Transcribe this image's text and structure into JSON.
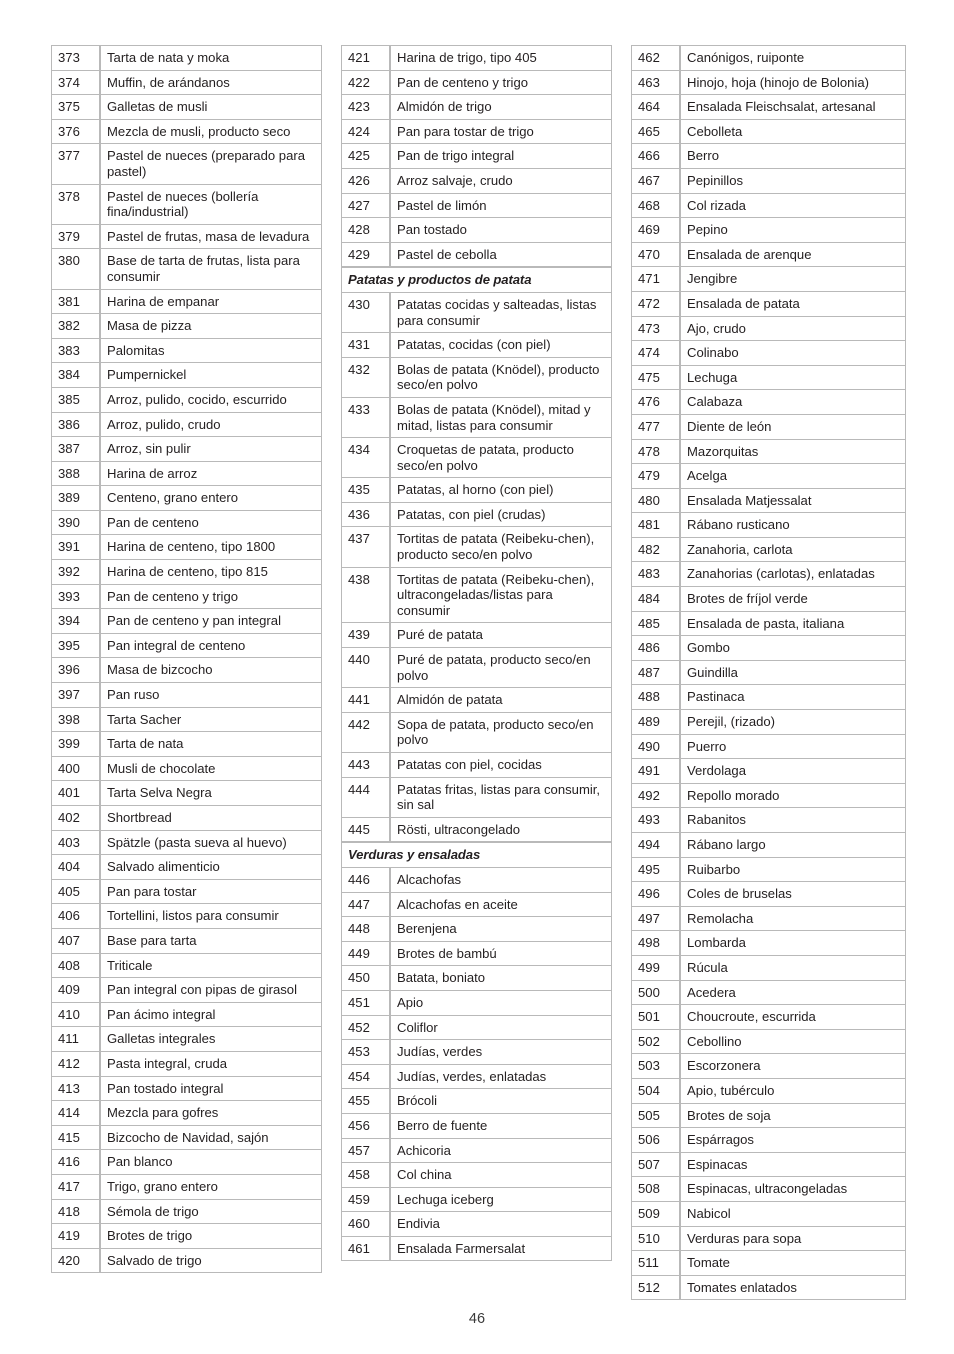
{
  "document": {
    "page_number": "46",
    "columns": [
      {
        "id": "column-1",
        "rows": [
          {
            "type": "entry",
            "num": "373",
            "name": "Tarta de nata y moka"
          },
          {
            "type": "entry",
            "num": "374",
            "name": "Muffin, de arándanos"
          },
          {
            "type": "entry",
            "num": "375",
            "name": "Galletas de musli"
          },
          {
            "type": "entry",
            "num": "376",
            "name": "Mezcla de musli, producto seco"
          },
          {
            "type": "entry",
            "num": "377",
            "name": "Pastel de nueces (preparado para pastel)"
          },
          {
            "type": "entry",
            "num": "378",
            "name": "Pastel de nueces (bollería fina/industrial)"
          },
          {
            "type": "entry",
            "num": "379",
            "name": "Pastel de frutas, masa de levadura"
          },
          {
            "type": "entry",
            "num": "380",
            "name": "Base de tarta de frutas, lista para consumir"
          },
          {
            "type": "entry",
            "num": "381",
            "name": "Harina de empanar"
          },
          {
            "type": "entry",
            "num": "382",
            "name": "Masa de pizza"
          },
          {
            "type": "entry",
            "num": "383",
            "name": "Palomitas"
          },
          {
            "type": "entry",
            "num": "384",
            "name": "Pumpernickel"
          },
          {
            "type": "entry",
            "num": "385",
            "name": "Arroz, pulido, cocido, escurrido"
          },
          {
            "type": "entry",
            "num": "386",
            "name": "Arroz, pulido, crudo"
          },
          {
            "type": "entry",
            "num": "387",
            "name": "Arroz, sin pulir"
          },
          {
            "type": "entry",
            "num": "388",
            "name": "Harina de arroz"
          },
          {
            "type": "entry",
            "num": "389",
            "name": "Centeno, grano entero"
          },
          {
            "type": "entry",
            "num": "390",
            "name": "Pan de centeno"
          },
          {
            "type": "entry",
            "num": "391",
            "name": "Harina de centeno, tipo 1800"
          },
          {
            "type": "entry",
            "num": "392",
            "name": "Harina de centeno, tipo 815"
          },
          {
            "type": "entry",
            "num": "393",
            "name": "Pan de centeno y trigo"
          },
          {
            "type": "entry",
            "num": "394",
            "name": "Pan de centeno y pan integral"
          },
          {
            "type": "entry",
            "num": "395",
            "name": "Pan integral de centeno"
          },
          {
            "type": "entry",
            "num": "396",
            "name": "Masa de bizcocho"
          },
          {
            "type": "entry",
            "num": "397",
            "name": "Pan ruso"
          },
          {
            "type": "entry",
            "num": "398",
            "name": "Tarta Sacher"
          },
          {
            "type": "entry",
            "num": "399",
            "name": "Tarta de nata"
          },
          {
            "type": "entry",
            "num": "400",
            "name": "Musli de chocolate"
          },
          {
            "type": "entry",
            "num": "401",
            "name": "Tarta Selva Negra"
          },
          {
            "type": "entry",
            "num": "402",
            "name": "Shortbread"
          },
          {
            "type": "entry",
            "num": "403",
            "name": "Spätzle (pasta sueva al huevo)"
          },
          {
            "type": "entry",
            "num": "404",
            "name": "Salvado alimenticio"
          },
          {
            "type": "entry",
            "num": "405",
            "name": "Pan para tostar"
          },
          {
            "type": "entry",
            "num": "406",
            "name": "Tortellini, listos para consumir"
          },
          {
            "type": "entry",
            "num": "407",
            "name": "Base para tarta"
          },
          {
            "type": "entry",
            "num": "408",
            "name": "Triticale"
          },
          {
            "type": "entry",
            "num": "409",
            "name": "Pan integral con pipas de girasol"
          },
          {
            "type": "entry",
            "num": "410",
            "name": "Pan ácimo integral"
          },
          {
            "type": "entry",
            "num": "411",
            "name": "Galletas integrales"
          },
          {
            "type": "entry",
            "num": "412",
            "name": "Pasta integral, cruda"
          },
          {
            "type": "entry",
            "num": "413",
            "name": "Pan tostado integral"
          },
          {
            "type": "entry",
            "num": "414",
            "name": "Mezcla para gofres"
          },
          {
            "type": "entry",
            "num": "415",
            "name": "Bizcocho de Navidad, sajón"
          },
          {
            "type": "entry",
            "num": "416",
            "name": "Pan blanco"
          },
          {
            "type": "entry",
            "num": "417",
            "name": "Trigo, grano entero"
          },
          {
            "type": "entry",
            "num": "418",
            "name": "Sémola de trigo"
          },
          {
            "type": "entry",
            "num": "419",
            "name": "Brotes de trigo"
          },
          {
            "type": "entry",
            "num": "420",
            "name": "Salvado de trigo"
          }
        ]
      },
      {
        "id": "column-2",
        "rows": [
          {
            "type": "entry",
            "num": "421",
            "name": "Harina de trigo, tipo 405"
          },
          {
            "type": "entry",
            "num": "422",
            "name": "Pan de centeno y trigo"
          },
          {
            "type": "entry",
            "num": "423",
            "name": "Almidón de trigo"
          },
          {
            "type": "entry",
            "num": "424",
            "name": "Pan para tostar de trigo"
          },
          {
            "type": "entry",
            "num": "425",
            "name": "Pan de trigo integral"
          },
          {
            "type": "entry",
            "num": "426",
            "name": "Arroz salvaje, crudo"
          },
          {
            "type": "entry",
            "num": "427",
            "name": "Pastel de limón"
          },
          {
            "type": "entry",
            "num": "428",
            "name": "Pan tostado"
          },
          {
            "type": "entry",
            "num": "429",
            "name": "Pastel de cebolla"
          },
          {
            "type": "section",
            "title": "Patatas y productos de patata"
          },
          {
            "type": "entry",
            "num": "430",
            "name": "Patatas cocidas y salteadas, listas para consumir"
          },
          {
            "type": "entry",
            "num": "431",
            "name": "Patatas, cocidas (con piel)"
          },
          {
            "type": "entry",
            "num": "432",
            "name": "Bolas de patata (Knödel), producto seco/en polvo"
          },
          {
            "type": "entry",
            "num": "433",
            "name": "Bolas de patata (Knödel), mitad y mitad, listas para consumir"
          },
          {
            "type": "entry",
            "num": "434",
            "name": "Croquetas de patata, producto seco/en polvo"
          },
          {
            "type": "entry",
            "num": "435",
            "name": "Patatas, al horno (con piel)"
          },
          {
            "type": "entry",
            "num": "436",
            "name": "Patatas, con piel (crudas)"
          },
          {
            "type": "entry",
            "num": "437",
            "name": "Tortitas de patata (Reibeku-chen), producto seco/en polvo"
          },
          {
            "type": "entry",
            "num": "438",
            "name": "Tortitas de patata (Reibeku-chen), ultracongeladas/listas para consumir"
          },
          {
            "type": "entry",
            "num": "439",
            "name": "Puré de patata"
          },
          {
            "type": "entry",
            "num": "440",
            "name": "Puré de patata, producto seco/en polvo"
          },
          {
            "type": "entry",
            "num": "441",
            "name": "Almidón de patata"
          },
          {
            "type": "entry",
            "num": "442",
            "name": "Sopa de patata, producto seco/en polvo"
          },
          {
            "type": "entry",
            "num": "443",
            "name": "Patatas con piel, cocidas"
          },
          {
            "type": "entry",
            "num": "444",
            "name": "Patatas fritas, listas para consumir, sin sal"
          },
          {
            "type": "entry",
            "num": "445",
            "name": "Rösti, ultracongelado"
          },
          {
            "type": "section",
            "title": "Verduras y ensaladas"
          },
          {
            "type": "entry",
            "num": "446",
            "name": "Alcachofas"
          },
          {
            "type": "entry",
            "num": "447",
            "name": "Alcachofas en aceite"
          },
          {
            "type": "entry",
            "num": "448",
            "name": "Berenjena"
          },
          {
            "type": "entry",
            "num": "449",
            "name": "Brotes de bambú"
          },
          {
            "type": "entry",
            "num": "450",
            "name": "Batata, boniato"
          },
          {
            "type": "entry",
            "num": "451",
            "name": "Apio"
          },
          {
            "type": "entry",
            "num": "452",
            "name": "Coliflor"
          },
          {
            "type": "entry",
            "num": "453",
            "name": "Judías, verdes"
          },
          {
            "type": "entry",
            "num": "454",
            "name": "Judías, verdes, enlatadas"
          },
          {
            "type": "entry",
            "num": "455",
            "name": "Brócoli"
          },
          {
            "type": "entry",
            "num": "456",
            "name": "Berro de fuente"
          },
          {
            "type": "entry",
            "num": "457",
            "name": "Achicoria"
          },
          {
            "type": "entry",
            "num": "458",
            "name": "Col china"
          },
          {
            "type": "entry",
            "num": "459",
            "name": "Lechuga iceberg"
          },
          {
            "type": "entry",
            "num": "460",
            "name": "Endivia"
          },
          {
            "type": "entry",
            "num": "461",
            "name": "Ensalada Farmersalat"
          }
        ]
      },
      {
        "id": "column-3",
        "rows": [
          {
            "type": "entry",
            "num": "462",
            "name": "Canónigos, ruiponte"
          },
          {
            "type": "entry",
            "num": "463",
            "name": "Hinojo, hoja (hinojo de Bolonia)"
          },
          {
            "type": "entry",
            "num": "464",
            "name": "Ensalada Fleischsalat, artesanal"
          },
          {
            "type": "entry",
            "num": "465",
            "name": "Cebolleta"
          },
          {
            "type": "entry",
            "num": "466",
            "name": "Berro"
          },
          {
            "type": "entry",
            "num": "467",
            "name": "Pepinillos"
          },
          {
            "type": "entry",
            "num": "468",
            "name": "Col rizada"
          },
          {
            "type": "entry",
            "num": "469",
            "name": "Pepino"
          },
          {
            "type": "entry",
            "num": "470",
            "name": "Ensalada de arenque"
          },
          {
            "type": "entry",
            "num": "471",
            "name": "Jengibre"
          },
          {
            "type": "entry",
            "num": "472",
            "name": "Ensalada de patata"
          },
          {
            "type": "entry",
            "num": "473",
            "name": "Ajo, crudo"
          },
          {
            "type": "entry",
            "num": "474",
            "name": "Colinabo"
          },
          {
            "type": "entry",
            "num": "475",
            "name": "Lechuga"
          },
          {
            "type": "entry",
            "num": "476",
            "name": "Calabaza"
          },
          {
            "type": "entry",
            "num": "477",
            "name": "Diente de león"
          },
          {
            "type": "entry",
            "num": "478",
            "name": "Mazorquitas"
          },
          {
            "type": "entry",
            "num": "479",
            "name": "Acelga"
          },
          {
            "type": "entry",
            "num": "480",
            "name": "Ensalada Matjessalat"
          },
          {
            "type": "entry",
            "num": "481",
            "name": "Rábano rusticano"
          },
          {
            "type": "entry",
            "num": "482",
            "name": "Zanahoria, carlota"
          },
          {
            "type": "entry",
            "num": "483",
            "name": "Zanahorias (carlotas), enlatadas"
          },
          {
            "type": "entry",
            "num": "484",
            "name": "Brotes de fríjol verde"
          },
          {
            "type": "entry",
            "num": "485",
            "name": "Ensalada de pasta, italiana"
          },
          {
            "type": "entry",
            "num": "486",
            "name": "Gombo"
          },
          {
            "type": "entry",
            "num": "487",
            "name": "Guindilla"
          },
          {
            "type": "entry",
            "num": "488",
            "name": "Pastinaca"
          },
          {
            "type": "entry",
            "num": "489",
            "name": "Perejil, (rizado)"
          },
          {
            "type": "entry",
            "num": "490",
            "name": "Puerro"
          },
          {
            "type": "entry",
            "num": "491",
            "name": "Verdolaga"
          },
          {
            "type": "entry",
            "num": "492",
            "name": "Repollo morado"
          },
          {
            "type": "entry",
            "num": "493",
            "name": "Rabanitos"
          },
          {
            "type": "entry",
            "num": "494",
            "name": "Rábano largo"
          },
          {
            "type": "entry",
            "num": "495",
            "name": "Ruibarbo"
          },
          {
            "type": "entry",
            "num": "496",
            "name": "Coles de bruselas"
          },
          {
            "type": "entry",
            "num": "497",
            "name": "Remolacha"
          },
          {
            "type": "entry",
            "num": "498",
            "name": "Lombarda"
          },
          {
            "type": "entry",
            "num": "499",
            "name": "Rúcula"
          },
          {
            "type": "entry",
            "num": "500",
            "name": "Acedera"
          },
          {
            "type": "entry",
            "num": "501",
            "name": "Choucroute, escurrida"
          },
          {
            "type": "entry",
            "num": "502",
            "name": "Cebollino"
          },
          {
            "type": "entry",
            "num": "503",
            "name": "Escorzonera"
          },
          {
            "type": "entry",
            "num": "504",
            "name": "Apio, tubérculo"
          },
          {
            "type": "entry",
            "num": "505",
            "name": "Brotes de soja"
          },
          {
            "type": "entry",
            "num": "506",
            "name": "Espárragos"
          },
          {
            "type": "entry",
            "num": "507",
            "name": "Espinacas"
          },
          {
            "type": "entry",
            "num": "508",
            "name": "Espinacas, ultracongeladas"
          },
          {
            "type": "entry",
            "num": "509",
            "name": "Nabicol"
          },
          {
            "type": "entry",
            "num": "510",
            "name": "Verduras para sopa"
          },
          {
            "type": "entry",
            "num": "511",
            "name": "Tomate"
          },
          {
            "type": "entry",
            "num": "512",
            "name": "Tomates enlatados"
          }
        ]
      }
    ]
  }
}
